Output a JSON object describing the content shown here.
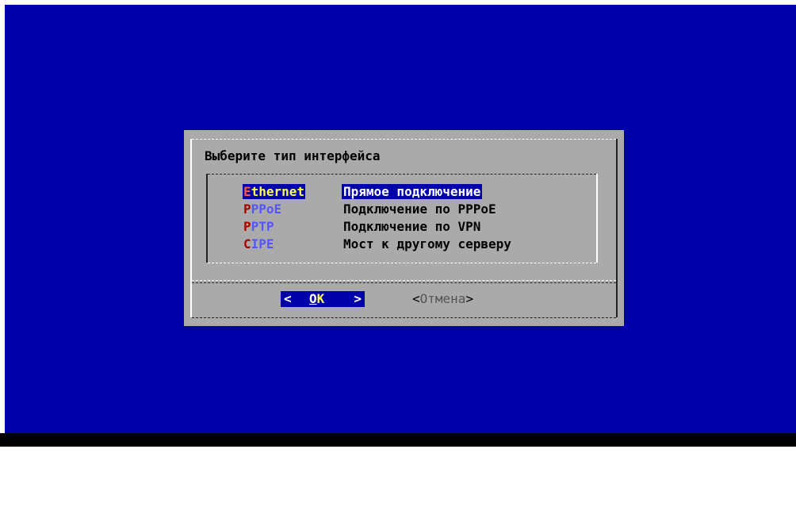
{
  "dialog": {
    "title": "Выберите тип интерфейса",
    "items": [
      {
        "tag_first": "E",
        "tag_rest": "thernet",
        "description": "Прямое подключение",
        "selected": true
      },
      {
        "tag_first": "P",
        "tag_rest": "PPoE",
        "description": "Подключение по PPPoE",
        "selected": false
      },
      {
        "tag_first": "P",
        "tag_rest": "PTP",
        "description": "Подключение по VPN",
        "selected": false
      },
      {
        "tag_first": "C",
        "tag_rest": "IPE",
        "description": "Мост к другому серверу",
        "selected": false
      }
    ],
    "buttons": {
      "ok_left": "<",
      "ok_hot": "О",
      "ok_rest": "К",
      "ok_right": ">",
      "cancel_left": "<",
      "cancel_label": "Отмена",
      "cancel_right": ">"
    }
  },
  "colors": {
    "background": "#0000aa",
    "dialog": "#aaaaaa",
    "selection": "#0000aa",
    "hotkey": "#aa0000",
    "tag": "#5555ff",
    "selected_tag": "#ffff55"
  }
}
